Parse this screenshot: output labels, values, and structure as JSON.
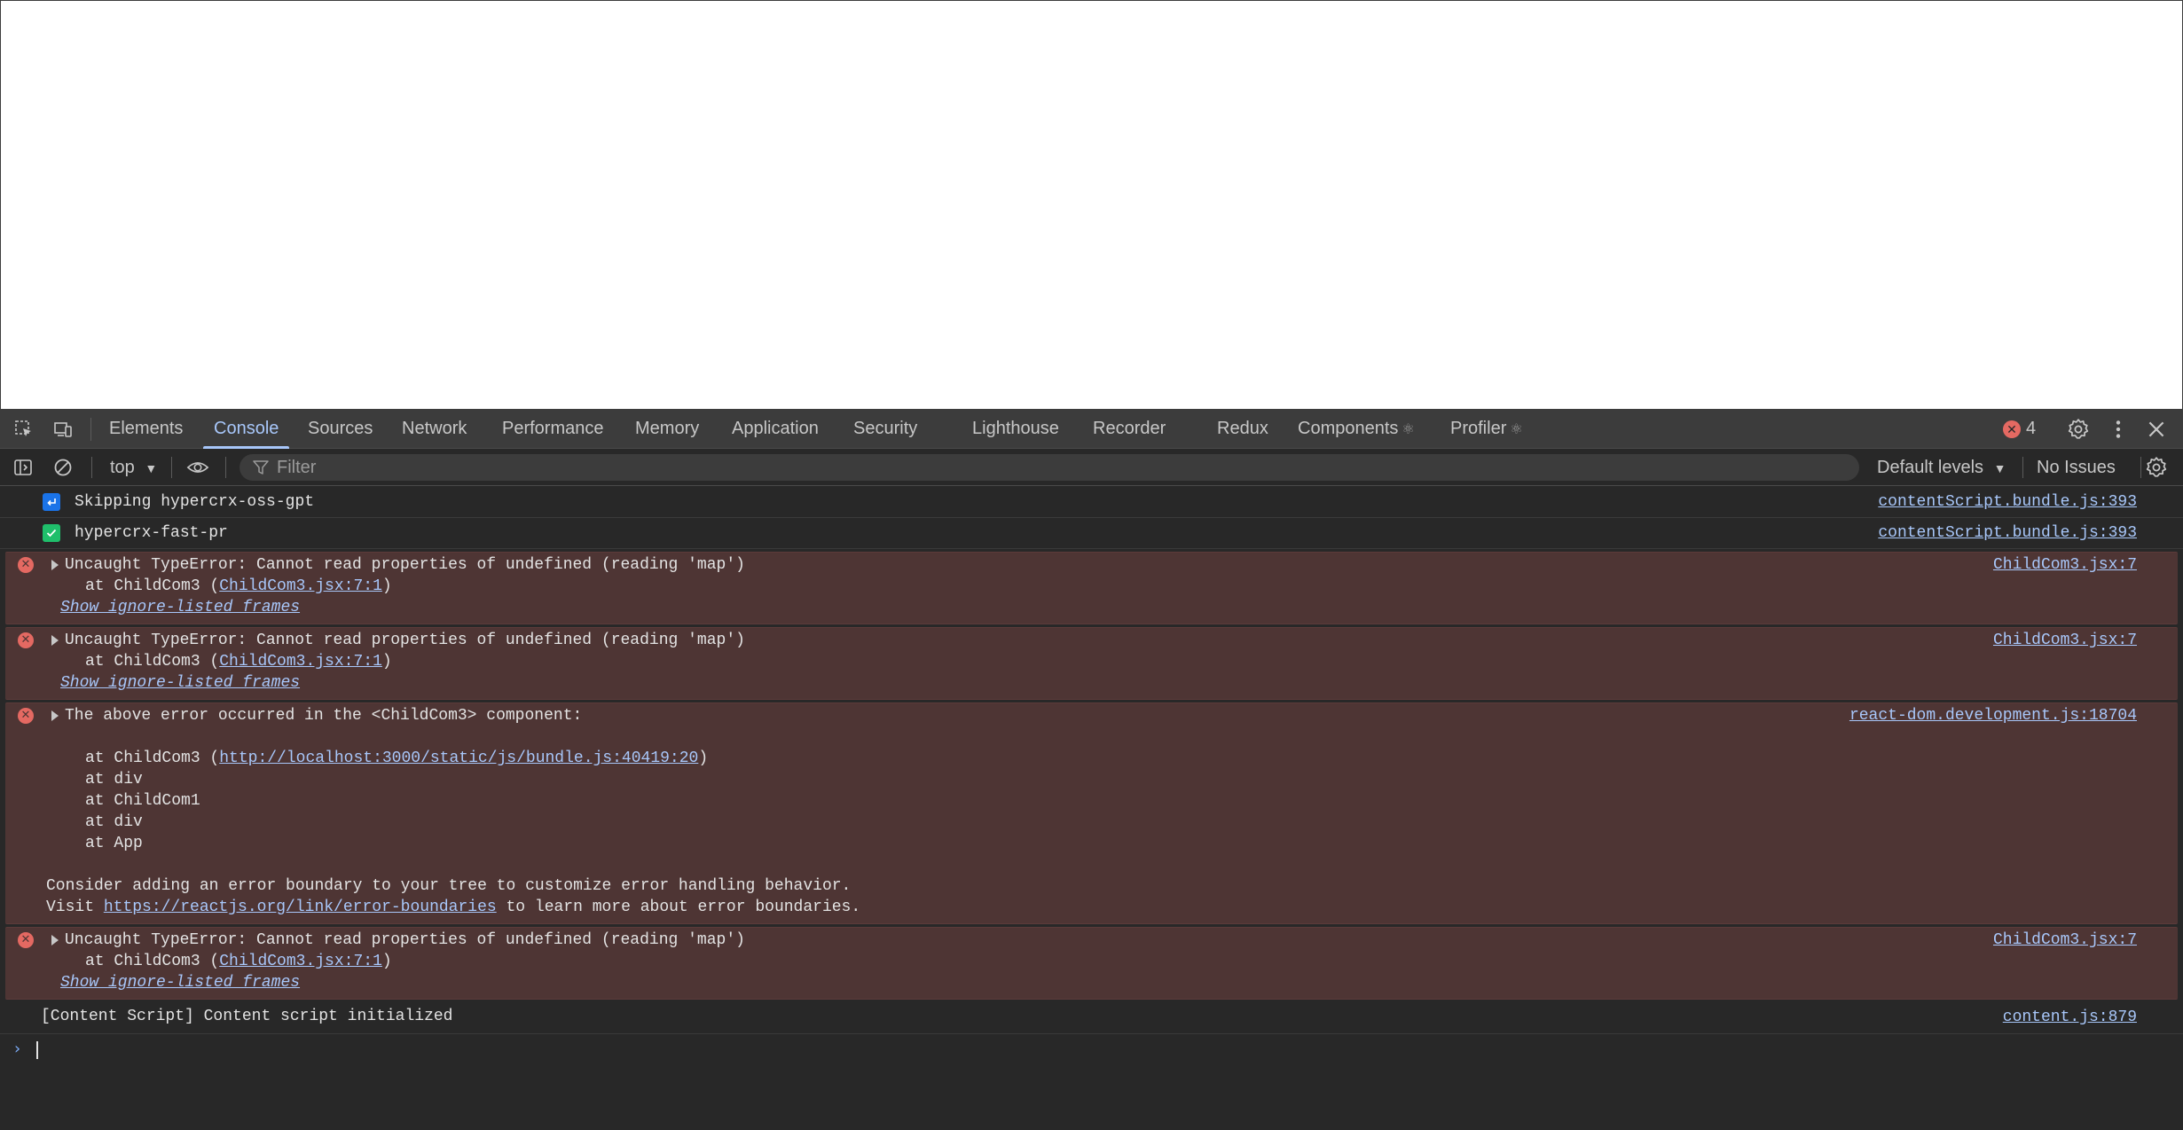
{
  "tabs": [
    {
      "label": "Elements",
      "active": false
    },
    {
      "label": "Console",
      "active": true
    },
    {
      "label": "Sources",
      "active": false
    },
    {
      "label": "Network",
      "active": false
    },
    {
      "label": "Performance",
      "active": false
    },
    {
      "label": "Memory",
      "active": false
    },
    {
      "label": "Application",
      "active": false
    },
    {
      "label": "Security",
      "active": false
    },
    {
      "label": "Lighthouse",
      "active": false
    },
    {
      "label": "Recorder",
      "active": false
    },
    {
      "label": "Redux",
      "active": false
    },
    {
      "label": "Components",
      "active": false
    },
    {
      "label": "Profiler",
      "active": false
    }
  ],
  "react_symbol": "⚛",
  "error_count": "4",
  "toolbar": {
    "context": "top",
    "filter_placeholder": "Filter",
    "levels": "Default levels",
    "issues": "No Issues"
  },
  "messages": {
    "m1": {
      "text": "Skipping hypercrx-oss-gpt",
      "source": "contentScript.bundle.js:393"
    },
    "m2": {
      "text": "hypercrx-fast-pr",
      "source": "contentScript.bundle.js:393"
    },
    "e1": {
      "text": "Uncaught TypeError: Cannot read properties of undefined (reading 'map')",
      "at_prefix": "at ChildCom3 (",
      "at_link": "ChildCom3.jsx:7:1",
      "at_suffix": ")",
      "ignore": "Show ignore-listed frames",
      "source": "ChildCom3.jsx:7"
    },
    "e2": {
      "text": "Uncaught TypeError: Cannot read properties of undefined (reading 'map')",
      "at_prefix": "at ChildCom3 (",
      "at_link": "ChildCom3.jsx:7:1",
      "at_suffix": ")",
      "ignore": "Show ignore-listed frames",
      "source": "ChildCom3.jsx:7"
    },
    "e3": {
      "text": "The above error occurred in the <ChildCom3> component:",
      "at_prefix": "at ChildCom3 (",
      "at_link": "http://localhost:3000/static/js/bundle.js:40419:20",
      "at_suffix": ")",
      "lines": [
        "at div",
        "at ChildCom1",
        "at div",
        "at App"
      ],
      "advice": "Consider adding an error boundary to your tree to customize error handling behavior.",
      "visit_prefix": "Visit ",
      "visit_link": "https://reactjs.org/link/error-boundaries",
      "visit_suffix": " to learn more about error boundaries.",
      "source": "react-dom.development.js:18704"
    },
    "e4": {
      "text": "Uncaught TypeError: Cannot read properties of undefined (reading 'map')",
      "at_prefix": "at ChildCom3 (",
      "at_link": "ChildCom3.jsx:7:1",
      "at_suffix": ")",
      "ignore": "Show ignore-listed frames",
      "source": "ChildCom3.jsx:7"
    },
    "m3": {
      "text": "[Content Script] Content script initialized",
      "source": "content.js:879"
    }
  },
  "prompt_symbol": "›",
  "colors": {
    "accent": "#a8c7fa",
    "error": "#e46962",
    "error_bg": "#4e3534",
    "panel_bg": "#282828",
    "tabbar_bg": "#3c3c3c",
    "success": "#1fbf6b",
    "info_badge": "#1a73e8"
  }
}
